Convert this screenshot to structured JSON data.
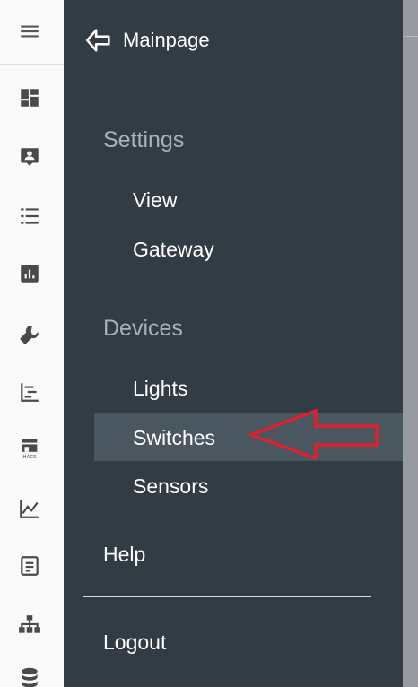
{
  "drawer": {
    "back_label": "Mainpage",
    "sections": [
      {
        "title": "Settings",
        "items": [
          "View",
          "Gateway"
        ]
      },
      {
        "title": "Devices",
        "items": [
          "Lights",
          "Switches",
          "Sensors"
        ]
      }
    ],
    "selected_item": "Switches",
    "help_label": "Help",
    "logout_label": "Logout"
  },
  "rail": {
    "icons": [
      "menu-icon",
      "dashboard-icon",
      "account-box-icon",
      "format-list-icon",
      "chart-box-icon",
      "wrench-icon",
      "chart-timeline-icon",
      "hacs-store-icon",
      "chart-line-icon",
      "file-document-icon",
      "sitemap-icon",
      "database-icon"
    ],
    "hacs_label": "HACS"
  },
  "colors": {
    "drawer_bg": "#313c45",
    "selected_bg": "#4a5761",
    "section_text": "#a9b0b6",
    "annotation_arrow": "#e0202a"
  }
}
